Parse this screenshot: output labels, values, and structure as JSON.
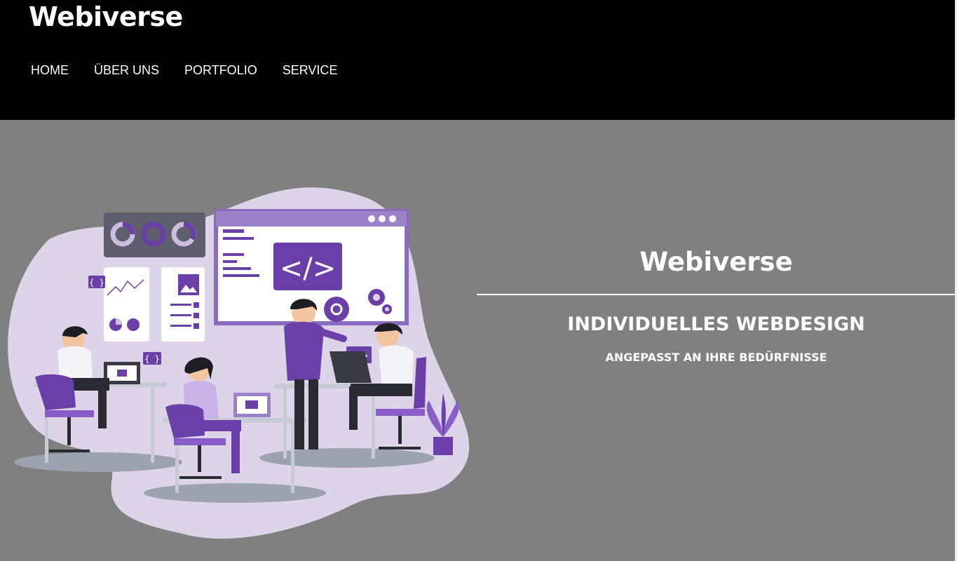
{
  "header": {
    "brand": "Webiverse",
    "nav": [
      {
        "label": "HOME"
      },
      {
        "label": "ÜBER UNS"
      },
      {
        "label": "PORTFOLIO"
      },
      {
        "label": "SERVICE"
      }
    ]
  },
  "hero": {
    "title": "Webiverse",
    "subtitle": "INDIVIDUELLES WEBDESIGN",
    "tagline": "ANGEPASST AN IHRE BEDÜRFNISSE",
    "illustration": {
      "icon": "team-web-development-illustration",
      "code_symbol": "</>",
      "braces_symbol": "{ }"
    }
  },
  "colors": {
    "header_bg": "#000000",
    "hero_bg": "#808080",
    "accent_purple": "#6a3fa8",
    "blob_lavender": "#ded4ea"
  }
}
